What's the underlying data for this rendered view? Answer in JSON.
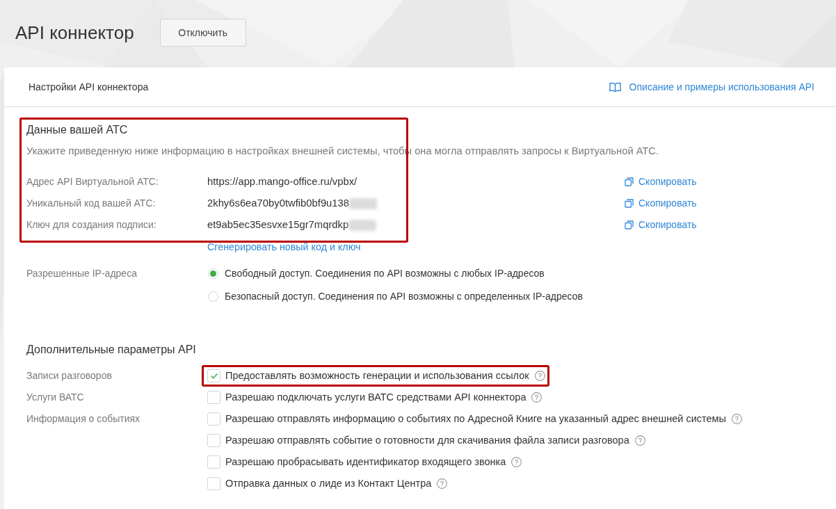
{
  "page": {
    "title": "API коннектор",
    "disable_button": "Отключить"
  },
  "card": {
    "heading": "Настройки API коннектора",
    "docs_link": "Описание и примеры использования API"
  },
  "ats_data": {
    "title": "Данные вашей АТС",
    "highlighted": true,
    "description": "Укажите приведенную ниже информацию в настройках внешней системы, чтобы она могла отправлять запросы к Виртуальной АТС.",
    "fields": [
      {
        "label": "Адрес API Виртуальной АТС:",
        "value": "https://app.mango-office.ru/vpbx/",
        "redacted": false,
        "copy_link": "Скопировать"
      },
      {
        "label": "Уникальный код вашей АТС:",
        "value": "2khy6s6ea70by0twfib0bf9u138",
        "redacted": true,
        "copy_link": "Скопировать"
      },
      {
        "label": "Ключ для создания подписи:",
        "value": "et9ab5ec35esvxe15gr7mqrdkp",
        "redacted": true,
        "copy_link": "Скопировать"
      }
    ],
    "generate_link": "Сгенерировать новый код и ключ"
  },
  "allowed_ip": {
    "label": "Разрешенные IP-адреса",
    "options": [
      {
        "text": "Свободный доступ. Соединения по API возможны с любых IP-адресов",
        "selected": true
      },
      {
        "text": "Безопасный доступ. Соединения по API возможны с определенных IP-адресов",
        "selected": false
      }
    ]
  },
  "extra_params": {
    "title": "Дополнительные параметры API",
    "rows": [
      {
        "label": "Записи разговоров",
        "text": "Предоставлять возможность генерации и использования ссылок",
        "checked": true,
        "highlighted": true
      },
      {
        "label": "Услуги ВАТС",
        "text": "Разрешаю подключать услуги ВАТС средствами API коннектора",
        "checked": false,
        "highlighted": false
      },
      {
        "label": "Информация о событиях",
        "text": "Разрешаю отправлять информацию о событиях по Адресной Книге на указанный адрес внешней системы",
        "checked": false,
        "highlighted": false
      },
      {
        "text": "Разрешаю отправлять событие о готовности для скачивания файла записи разговора",
        "checked": false,
        "highlighted": false
      },
      {
        "text": "Разрешаю пробрасывать идентификатор входящего звонка",
        "checked": false,
        "highlighted": false
      },
      {
        "text": "Отправка данных о лиде из Контакт Центра",
        "checked": false,
        "highlighted": false
      }
    ]
  }
}
